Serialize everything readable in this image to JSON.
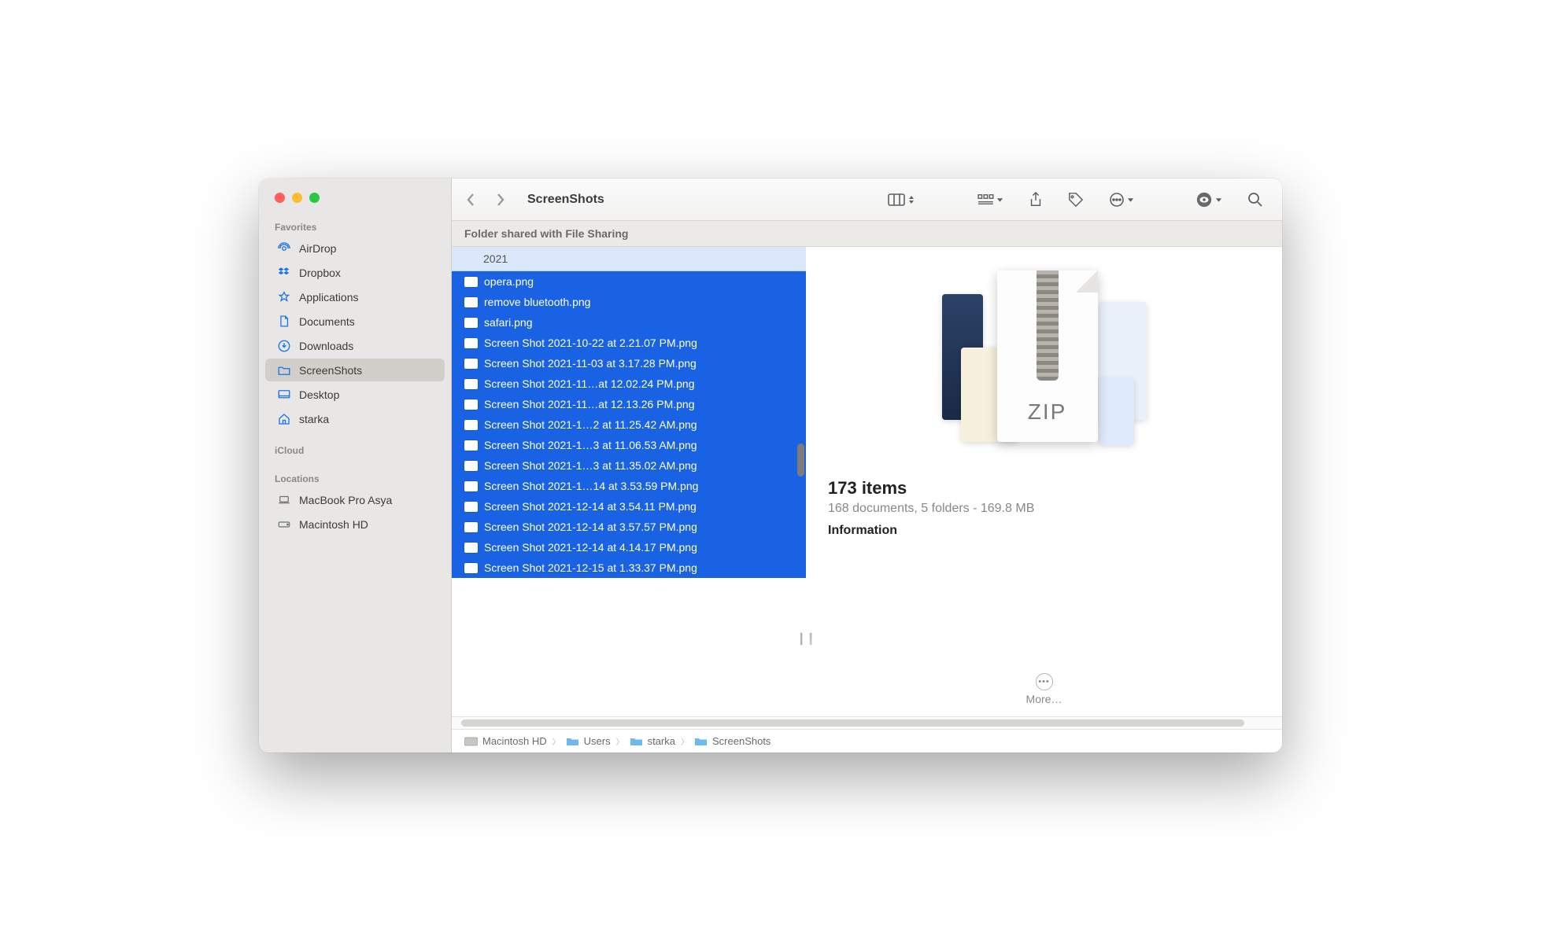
{
  "window": {
    "title": "ScreenShots"
  },
  "banner": "Folder shared with File Sharing",
  "sidebar": {
    "sections": [
      {
        "label": "Favorites",
        "items": [
          {
            "icon": "airdrop",
            "label": "AirDrop"
          },
          {
            "icon": "dropbox",
            "label": "Dropbox"
          },
          {
            "icon": "apps",
            "label": "Applications"
          },
          {
            "icon": "doc",
            "label": "Documents"
          },
          {
            "icon": "download",
            "label": "Downloads"
          },
          {
            "icon": "folder",
            "label": "ScreenShots",
            "active": true
          },
          {
            "icon": "desktop",
            "label": "Desktop"
          },
          {
            "icon": "home",
            "label": "starka"
          }
        ]
      },
      {
        "label": "iCloud",
        "items": []
      },
      {
        "label": "Locations",
        "items": [
          {
            "icon": "laptop",
            "label": "MacBook Pro Asya",
            "gray": true
          },
          {
            "icon": "disk",
            "label": "Macintosh HD",
            "gray": true
          }
        ]
      }
    ]
  },
  "column": {
    "header": "2021",
    "files": [
      "opera.png",
      "remove bluetooth.png",
      "safari.png",
      "Screen Shot 2021-10-22 at 2.21.07 PM.png",
      "Screen Shot 2021-11-03 at 3.17.28 PM.png",
      "Screen Shot 2021-11…at 12.02.24 PM.png",
      "Screen Shot 2021-11…at 12.13.26 PM.png",
      "Screen Shot 2021-1…2 at 11.25.42 AM.png",
      "Screen Shot 2021-1…3 at 11.06.53 AM.png",
      "Screen Shot 2021-1…3 at 11.35.02 AM.png",
      "Screen Shot 2021-1…14 at 3.53.59 PM.png",
      "Screen Shot 2021-12-14 at 3.54.11 PM.png",
      "Screen Shot 2021-12-14 at 3.57.57 PM.png",
      "Screen Shot 2021-12-14 at 4.14.17 PM.png",
      "Screen Shot 2021-12-15 at 1.33.37 PM.png"
    ]
  },
  "preview": {
    "zip_label": "ZIP",
    "title": "173 items",
    "subtitle": "168 documents, 5 folders - 169.8 MB",
    "info_heading": "Information",
    "more": "More…"
  },
  "pathbar": [
    {
      "icon": "hd",
      "label": "Macintosh HD"
    },
    {
      "icon": "folder-blue",
      "label": "Users"
    },
    {
      "icon": "folder-blue",
      "label": "starka"
    },
    {
      "icon": "folder-blue",
      "label": "ScreenShots"
    }
  ]
}
